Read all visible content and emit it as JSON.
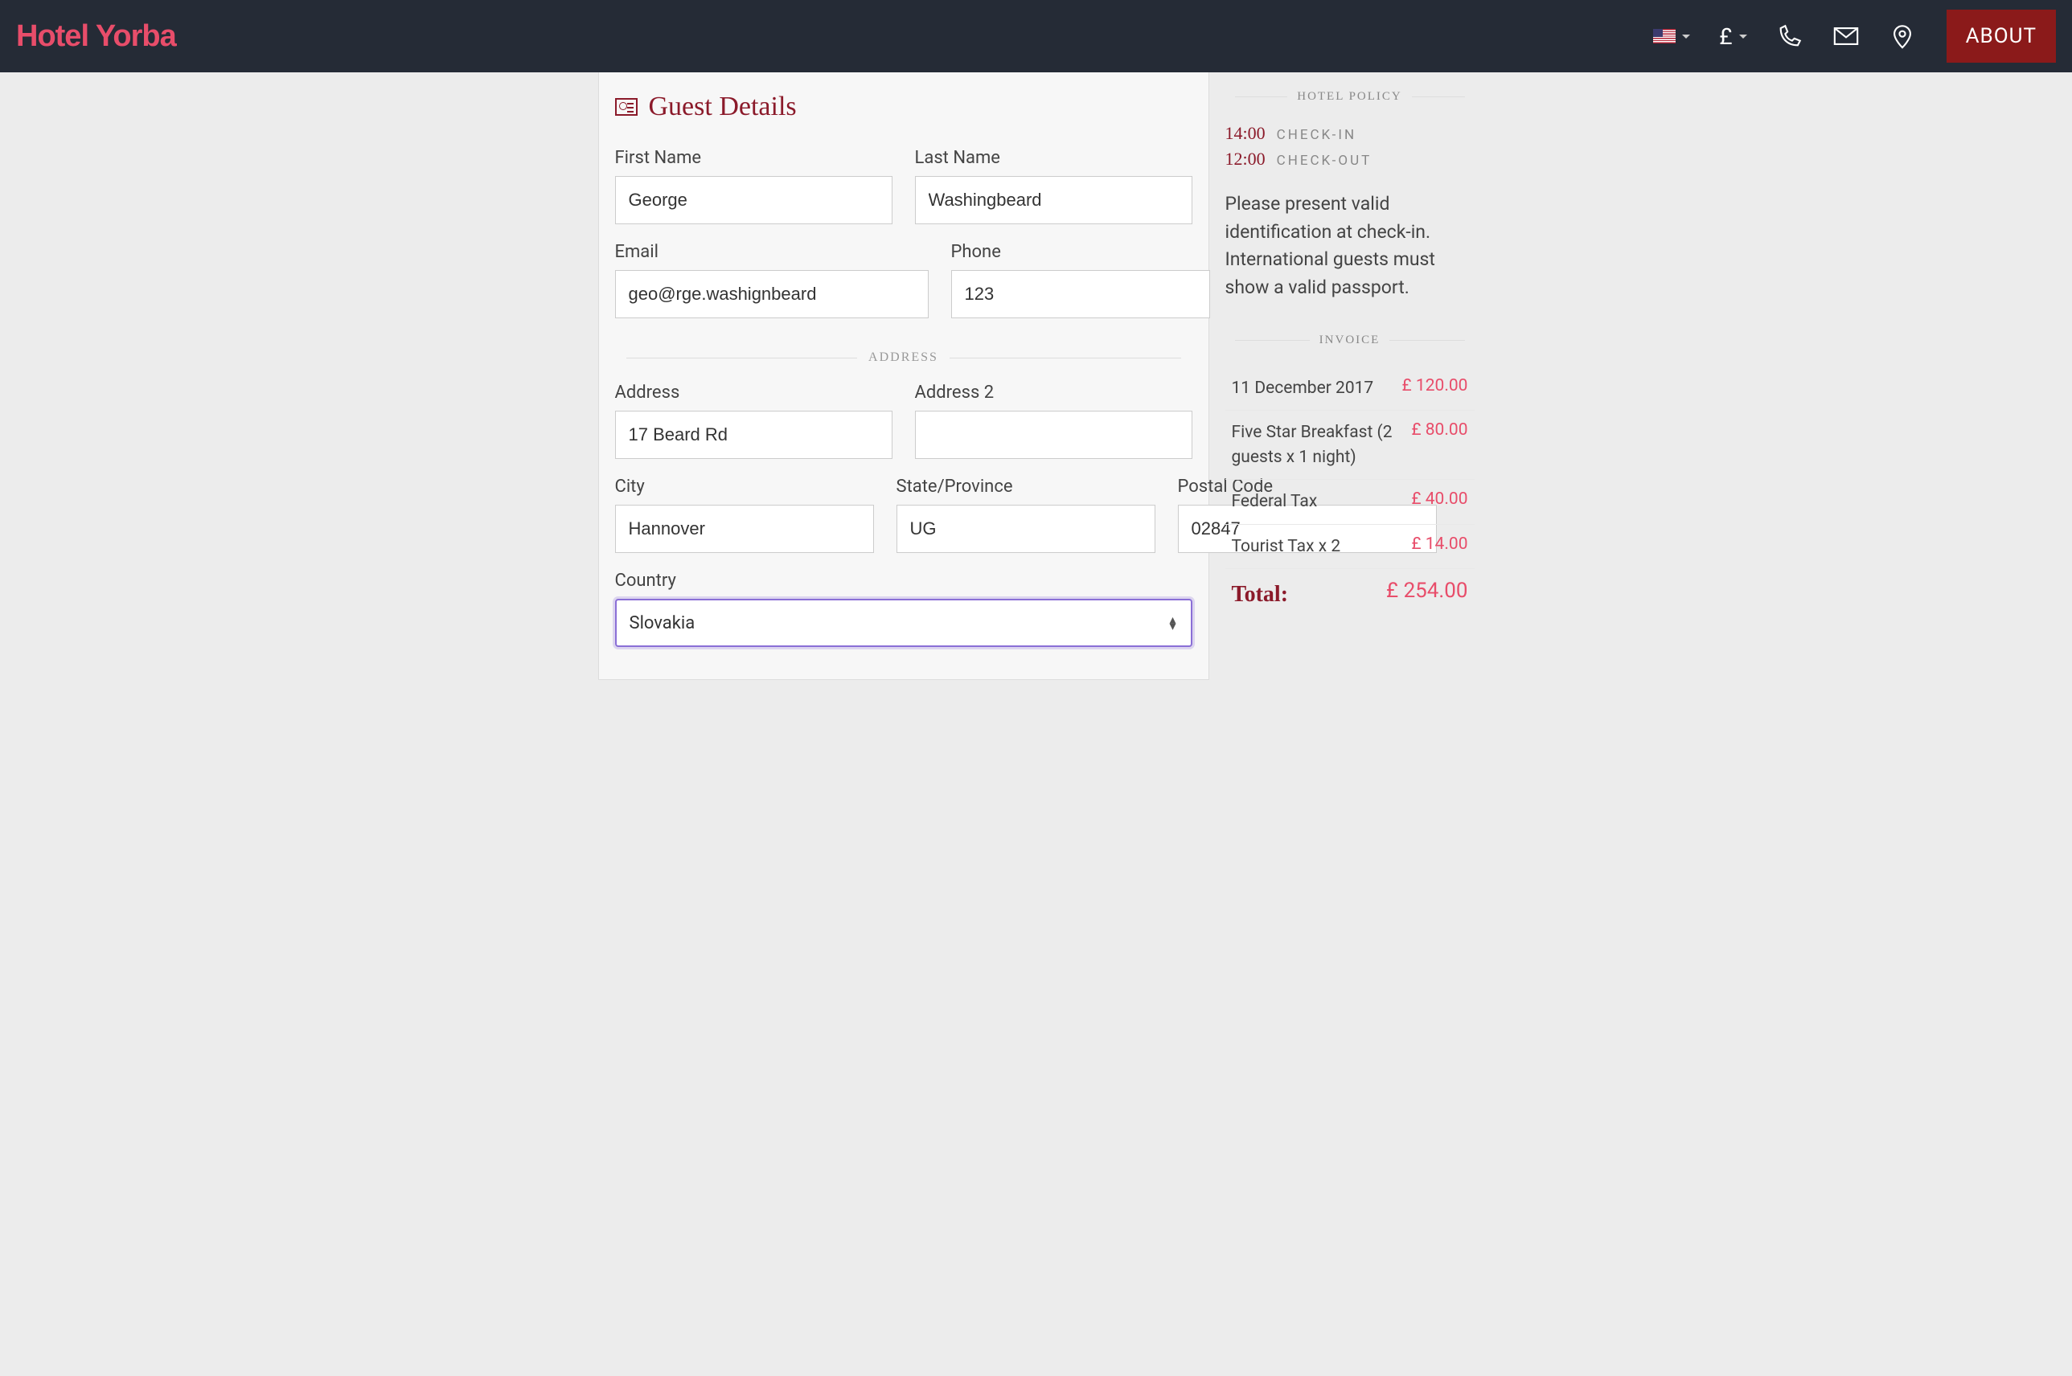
{
  "header": {
    "brand": "Hotel Yorba",
    "currency_symbol": "£",
    "about_label": "ABOUT"
  },
  "guest_details": {
    "title": "Guest Details",
    "first_name_label": "First Name",
    "first_name_value": "George",
    "last_name_label": "Last Name",
    "last_name_value": "Washingbeard",
    "email_label": "Email",
    "email_value": "geo@rge.washignbeard",
    "phone_label": "Phone",
    "phone_value": "123",
    "address_divider": "ADDRESS",
    "address_label": "Address",
    "address_value": "17 Beard Rd",
    "address2_label": "Address 2",
    "address2_value": "",
    "city_label": "City",
    "city_value": "Hannover",
    "state_label": "State/Province",
    "state_value": "UG",
    "postal_label": "Postal Code",
    "postal_value": "02847",
    "country_label": "Country",
    "country_value": "Slovakia"
  },
  "policy": {
    "heading": "HOTEL POLICY",
    "checkin_time": "14:00",
    "checkin_label": "CHECK-IN",
    "checkout_time": "12:00",
    "checkout_label": "CHECK-OUT",
    "text": "Please present valid identification at check-in. International guests must show a valid passport."
  },
  "invoice": {
    "heading": "INVOICE",
    "items": [
      {
        "desc": "11 December 2017",
        "amount": "£ 120.00"
      },
      {
        "desc": "Five Star Breakfast (2 guests x 1 night)",
        "amount": "£ 80.00"
      },
      {
        "desc": "Federal Tax",
        "amount": "£ 40.00"
      },
      {
        "desc": "Tourist Tax x 2",
        "amount": "£ 14.00"
      }
    ],
    "total_label": "Total:",
    "total_amount": "£ 254.00"
  }
}
